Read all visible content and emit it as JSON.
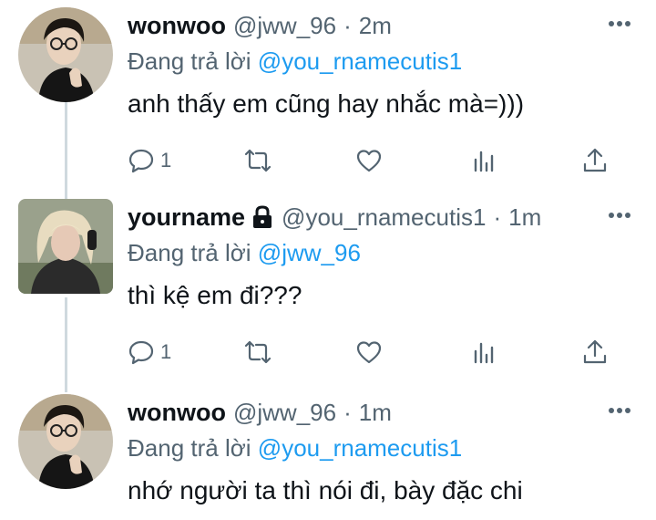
{
  "tweets": [
    {
      "name": "wonwoo",
      "handle": "@jww_96",
      "separator": "·",
      "time": "2m",
      "reply_prefix": "Đang trả lời",
      "reply_to": "@you_rnamecutis1",
      "text": "anh thấy em cũng hay nhắc mà=)))",
      "reply_count": "1",
      "locked": false,
      "avatar_icon": "avatar-photo"
    },
    {
      "name": "yourname",
      "handle": "@you_rnamecutis1",
      "separator": "·",
      "time": "1m",
      "reply_prefix": "Đang trả lời",
      "reply_to": "@jww_96",
      "text": "thì kệ em đi???",
      "reply_count": "1",
      "locked": true,
      "avatar_icon": "avatar-photo"
    },
    {
      "name": "wonwoo",
      "handle": "@jww_96",
      "separator": "·",
      "time": "1m",
      "reply_prefix": "Đang trả lời",
      "reply_to": "@you_rnamecutis1",
      "text": "nhớ người ta thì nói đi, bày đặc chi",
      "locked": false,
      "avatar_icon": "avatar-photo"
    }
  ],
  "icons": {
    "reply": "reply-icon",
    "retweet": "retweet-icon",
    "like": "heart-icon",
    "analytics": "analytics-icon",
    "share": "share-icon",
    "more": "more-icon",
    "lock": "lock-icon"
  },
  "colors": {
    "text": "#0f1419",
    "secondary": "#536471",
    "mention": "#1d9bf0",
    "thread_line": "#cfd9de"
  }
}
